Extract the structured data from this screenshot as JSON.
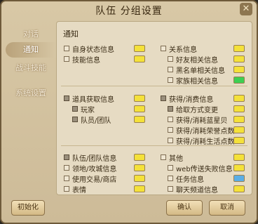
{
  "window": {
    "title": "队伍 分组设置",
    "close_glyph": "✕"
  },
  "sidebar": {
    "tabs": [
      {
        "label": "对话",
        "active": false
      },
      {
        "label": "通知",
        "active": true
      },
      {
        "label": "战斗技能",
        "active": false
      },
      {
        "label": "系统设置",
        "active": false
      }
    ]
  },
  "panel": {
    "title": "通知"
  },
  "colors": {
    "yellow": "#f4e13a",
    "green": "#3dcf52",
    "blue": "#5aaee6"
  },
  "settings": [
    {
      "label": "自身状态信息",
      "checked": false,
      "color": "yellow"
    },
    {
      "label": "技能信息",
      "checked": false,
      "color": "yellow"
    },
    {
      "label": "关系信息",
      "checked": false,
      "color": "yellow"
    },
    {
      "label": "好友相关信息",
      "checked": false,
      "color": "yellow"
    },
    {
      "label": "黑名单相关信息",
      "checked": false,
      "color": "yellow"
    },
    {
      "label": "家族相关信息",
      "checked": false,
      "color": "green"
    },
    {
      "label": "道具获取信息",
      "checked": true,
      "color": "yellow"
    },
    {
      "label": "玩家",
      "checked": true,
      "color": "yellow"
    },
    {
      "label": "队员/团队",
      "checked": true,
      "color": "yellow"
    },
    {
      "label": "获得/消费信息",
      "checked": true,
      "color": "yellow"
    },
    {
      "label": "给取方式变更",
      "checked": true,
      "color": "yellow"
    },
    {
      "label": "获得/消耗蓝星贝",
      "checked": false,
      "color": "yellow"
    },
    {
      "label": "获得/消耗荣誉点数",
      "checked": false,
      "color": "yellow"
    },
    {
      "label": "获得/消耗生活点数",
      "checked": false,
      "color": "yellow"
    },
    {
      "label": "队伍/团队信息",
      "checked": true,
      "color": "yellow"
    },
    {
      "label": "领地/攻城信息",
      "checked": false,
      "color": "yellow"
    },
    {
      "label": "使用交易/商店",
      "checked": false,
      "color": "yellow"
    },
    {
      "label": "表情",
      "checked": false,
      "color": "yellow"
    },
    {
      "label": "其他",
      "checked": false,
      "color": "yellow"
    },
    {
      "label": "web传送失败信息",
      "checked": false,
      "color": "yellow"
    },
    {
      "label": "任务信息",
      "checked": false,
      "color": "blue"
    },
    {
      "label": "聊天频道信息",
      "checked": false,
      "color": "yellow"
    }
  ],
  "buttons": {
    "reset": "初始化",
    "confirm": "确认",
    "cancel": "取消"
  }
}
